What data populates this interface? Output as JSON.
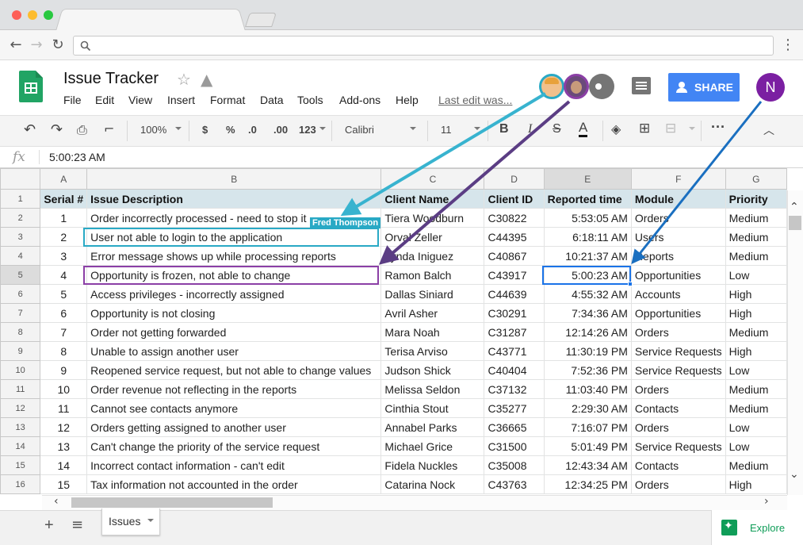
{
  "app": {
    "title": "Issue Tracker",
    "menu": [
      "File",
      "Edit",
      "View",
      "Insert",
      "Format",
      "Data",
      "Tools",
      "Add-ons",
      "Help"
    ],
    "last_edit": "Last edit was...",
    "share_label": "SHARE",
    "account_initial": "N",
    "collaborator_label": "Fred Thompson"
  },
  "toolbar": {
    "zoom": "100%",
    "currency": "$",
    "percent": "%",
    "decrease_decimals": ".0",
    "increase_decimals": ".00",
    "more_formats": "123",
    "font": "Calibri",
    "font_size": "11",
    "bold": "B",
    "italic": "I",
    "strikethrough": "S",
    "text_color": "A"
  },
  "formula_bar": {
    "fx": "fx",
    "value": "5:00:23 AM"
  },
  "grid": {
    "columns": [
      "A",
      "B",
      "C",
      "D",
      "E",
      "F",
      "G"
    ],
    "header_row": [
      "Serial #",
      "Issue Description",
      "Client Name",
      "Client ID",
      "Reported time",
      "Module",
      "Priority"
    ],
    "rows": [
      [
        "1",
        "Order incorrectly processed - need to stop it",
        "Tiera Woodburn",
        "C30822",
        "5:53:05 AM",
        "Orders",
        "Medium"
      ],
      [
        "2",
        "User not able to login to the application",
        "Orval Zeller",
        "C44395",
        "6:18:11 AM",
        "Users",
        "Medium"
      ],
      [
        "3",
        "Error message shows up while processing reports",
        "Lynda Iniguez",
        "C40867",
        "10:21:37 AM",
        "Reports",
        "Medium"
      ],
      [
        "4",
        "Opportunity is frozen, not able to change",
        "Ramon Balch",
        "C43917",
        "5:00:23 AM",
        "Opportunities",
        "Low"
      ],
      [
        "5",
        "Access privileges - incorrectly assigned",
        "Dallas Siniard",
        "C44639",
        "4:55:32 AM",
        "Accounts",
        "High"
      ],
      [
        "6",
        "Opportunity is not closing",
        "Avril Asher",
        "C30291",
        "7:34:36 AM",
        "Opportunities",
        "High"
      ],
      [
        "7",
        "Order not getting forwarded",
        "Mara Noah",
        "C31287",
        "12:14:26 AM",
        "Orders",
        "Medium"
      ],
      [
        "8",
        "Unable to assign another user",
        "Terisa Arviso",
        "C43771",
        "11:30:19 PM",
        "Service Requests",
        "High"
      ],
      [
        "9",
        "Reopened service request, but not able to change values",
        "Judson Shick",
        "C40404",
        "7:52:36 PM",
        "Service Requests",
        "Low"
      ],
      [
        "10",
        "Order revenue not reflecting in the reports",
        "Melissa Seldon",
        "C37132",
        "11:03:40 PM",
        "Orders",
        "Medium"
      ],
      [
        "11",
        "Cannot see contacts anymore",
        "Cinthia Stout",
        "C35277",
        "2:29:30 AM",
        "Contacts",
        "Medium"
      ],
      [
        "12",
        "Orders getting assigned to another user",
        "Annabel Parks",
        "C36665",
        "7:16:07 PM",
        "Orders",
        "Low"
      ],
      [
        "13",
        "Can't change the priority of the service request",
        "Michael Grice",
        "C31500",
        "5:01:49 PM",
        "Service Requests",
        "Low"
      ],
      [
        "14",
        "Incorrect contact information - can't edit",
        "Fidela Nuckles",
        "C35008",
        "12:43:34 AM",
        "Contacts",
        "Medium"
      ],
      [
        "15",
        "Tax information not accounted in the order",
        "Catarina Nock",
        "C43763",
        "12:34:25 PM",
        "Orders",
        "High"
      ]
    ]
  },
  "bottom": {
    "sheet_tab": "Issues",
    "explore": "Explore"
  },
  "colors": {
    "brand_green": "#21a464",
    "share_blue": "#4285f4",
    "fred_teal": "#29a9c5",
    "collab_purple": "#8b3fa6",
    "self_blue": "#1a73c8",
    "header_fill": "#d6e5eb"
  }
}
